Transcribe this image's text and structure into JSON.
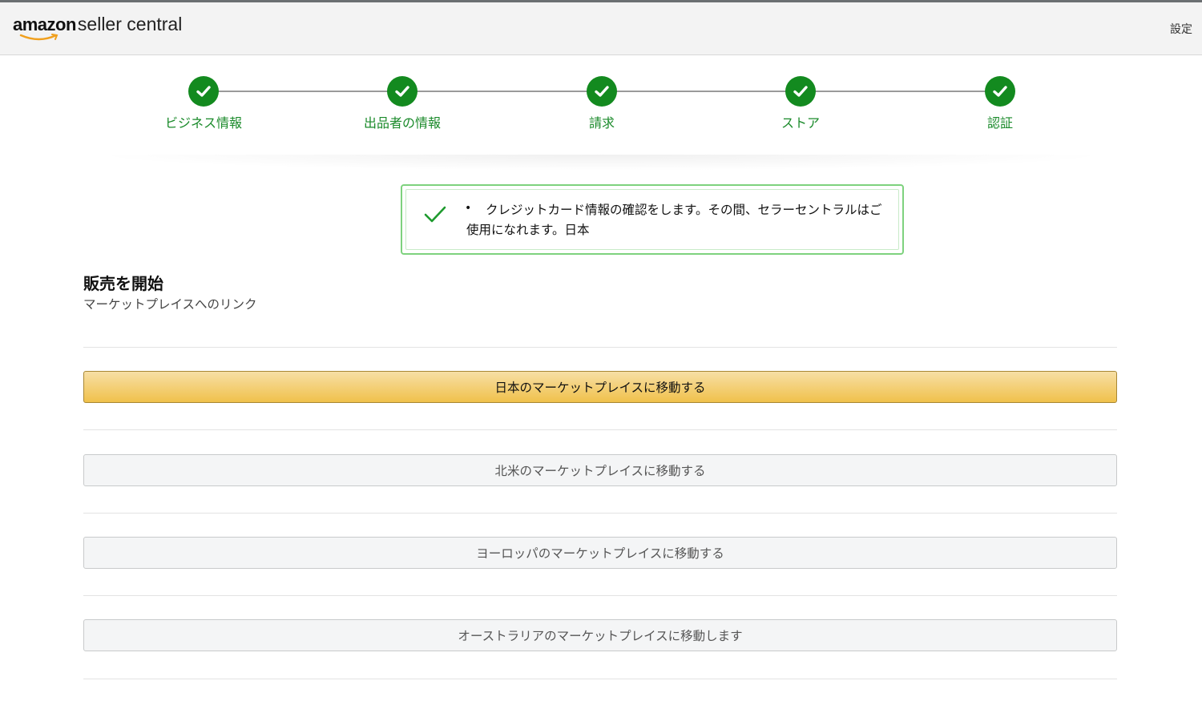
{
  "header": {
    "logo_amazon": "amazon",
    "logo_product": "seller central",
    "settings_label": "設定"
  },
  "steps": [
    {
      "label": "ビジネス情報",
      "status": "complete"
    },
    {
      "label": "出品者の情報",
      "status": "complete"
    },
    {
      "label": "請求",
      "status": "complete"
    },
    {
      "label": "ストア",
      "status": "complete"
    },
    {
      "label": "認証",
      "status": "complete"
    }
  ],
  "alert": {
    "icon": "checkmark-icon",
    "text": "クレジットカード情報の確認をします。その間、セラーセントラルはご使用になれます。日本"
  },
  "section": {
    "title": "販売を開始",
    "subtitle": "マーケットプレイスへのリンク"
  },
  "marketplace_buttons": [
    {
      "label": "日本のマーケットプレイスに移動する",
      "primary": true
    },
    {
      "label": "北米のマーケットプレイスに移動する",
      "primary": false
    },
    {
      "label": "ヨーロッパのマーケットプレイスに移動する",
      "primary": false
    },
    {
      "label": "オーストラリアのマーケットプレイスに移動します",
      "primary": false
    }
  ],
  "colors": {
    "step_complete": "#138a1f",
    "step_label": "#1a8a2a",
    "primary_button": "#f0c14b",
    "alert_border": "#7ed27e"
  }
}
